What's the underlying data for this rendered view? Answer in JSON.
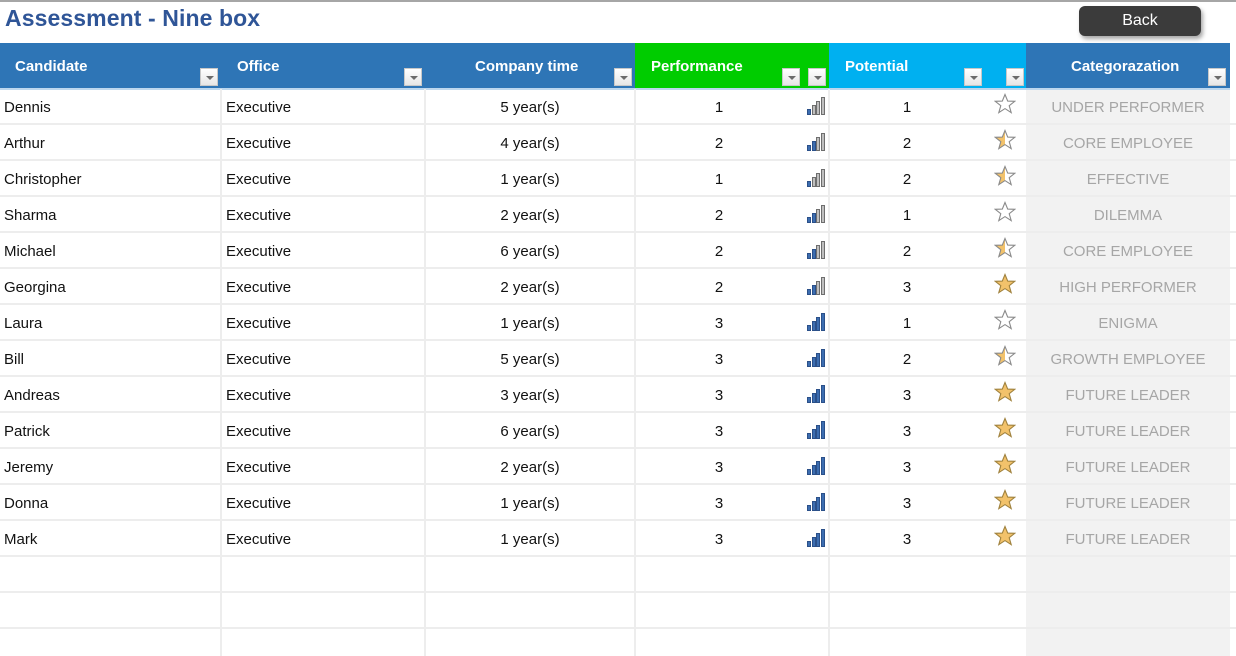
{
  "page": {
    "title": "Assessment - Nine box",
    "back_label": "Back"
  },
  "colors": {
    "header_blue": "#2e75b6",
    "performance_green": "#00cc00",
    "potential_cyan": "#00b0f0",
    "title_blue": "#2f5597",
    "star_gold": "#f2c26b",
    "bar_blue": "#3c6db0"
  },
  "columns": [
    {
      "key": "candidate",
      "label": "Candidate",
      "filters": 1
    },
    {
      "key": "office",
      "label": "Office",
      "filters": 1
    },
    {
      "key": "company_time",
      "label": "Company time",
      "filters": 1
    },
    {
      "key": "performance",
      "label": "Performance",
      "filters": 2
    },
    {
      "key": "potential",
      "label": "Potential",
      "filters": 2
    },
    {
      "key": "categorization",
      "label": "Categorazation",
      "filters": 1
    }
  ],
  "rows": [
    {
      "candidate": "Dennis",
      "office": "Executive",
      "company_time": "5 year(s)",
      "performance": "1",
      "performance_icon": "signal-bars-1-of-4",
      "potential": "1",
      "potential_icon": "star-empty",
      "categorization": "UNDER PERFORMER"
    },
    {
      "candidate": "Arthur",
      "office": "Executive",
      "company_time": "4 year(s)",
      "performance": "2",
      "performance_icon": "signal-bars-2-of-4",
      "potential": "2",
      "potential_icon": "star-half",
      "categorization": "CORE EMPLOYEE"
    },
    {
      "candidate": "Christopher",
      "office": "Executive",
      "company_time": "1 year(s)",
      "performance": "1",
      "performance_icon": "signal-bars-1-of-4",
      "potential": "2",
      "potential_icon": "star-half",
      "categorization": "EFFECTIVE"
    },
    {
      "candidate": "Sharma",
      "office": "Executive",
      "company_time": "2 year(s)",
      "performance": "2",
      "performance_icon": "signal-bars-2-of-4",
      "potential": "1",
      "potential_icon": "star-empty",
      "categorization": "DILEMMA"
    },
    {
      "candidate": "Michael",
      "office": "Executive",
      "company_time": "6 year(s)",
      "performance": "2",
      "performance_icon": "signal-bars-2-of-4",
      "potential": "2",
      "potential_icon": "star-half",
      "categorization": "CORE EMPLOYEE"
    },
    {
      "candidate": "Georgina",
      "office": "Executive",
      "company_time": "2 year(s)",
      "performance": "2",
      "performance_icon": "signal-bars-2-of-4",
      "potential": "3",
      "potential_icon": "star-full",
      "categorization": "HIGH PERFORMER"
    },
    {
      "candidate": "Laura",
      "office": "Executive",
      "company_time": "1 year(s)",
      "performance": "3",
      "performance_icon": "signal-bars-4-of-4",
      "potential": "1",
      "potential_icon": "star-empty",
      "categorization": "ENIGMA"
    },
    {
      "candidate": "Bill",
      "office": "Executive",
      "company_time": "5 year(s)",
      "performance": "3",
      "performance_icon": "signal-bars-4-of-4",
      "potential": "2",
      "potential_icon": "star-half",
      "categorization": "GROWTH EMPLOYEE"
    },
    {
      "candidate": "Andreas",
      "office": "Executive",
      "company_time": "3 year(s)",
      "performance": "3",
      "performance_icon": "signal-bars-4-of-4",
      "potential": "3",
      "potential_icon": "star-full",
      "categorization": "FUTURE LEADER"
    },
    {
      "candidate": "Patrick",
      "office": "Executive",
      "company_time": "6 year(s)",
      "performance": "3",
      "performance_icon": "signal-bars-4-of-4",
      "potential": "3",
      "potential_icon": "star-full",
      "categorization": "FUTURE LEADER"
    },
    {
      "candidate": "Jeremy",
      "office": "Executive",
      "company_time": "2 year(s)",
      "performance": "3",
      "performance_icon": "signal-bars-4-of-4",
      "potential": "3",
      "potential_icon": "star-full",
      "categorization": "FUTURE LEADER"
    },
    {
      "candidate": "Donna",
      "office": "Executive",
      "company_time": "1 year(s)",
      "performance": "3",
      "performance_icon": "signal-bars-4-of-4",
      "potential": "3",
      "potential_icon": "star-full",
      "categorization": "FUTURE LEADER"
    },
    {
      "candidate": "Mark",
      "office": "Executive",
      "company_time": "1 year(s)",
      "performance": "3",
      "performance_icon": "signal-bars-4-of-4",
      "potential": "3",
      "potential_icon": "star-full",
      "categorization": "FUTURE LEADER"
    }
  ],
  "empty_rows": 3
}
